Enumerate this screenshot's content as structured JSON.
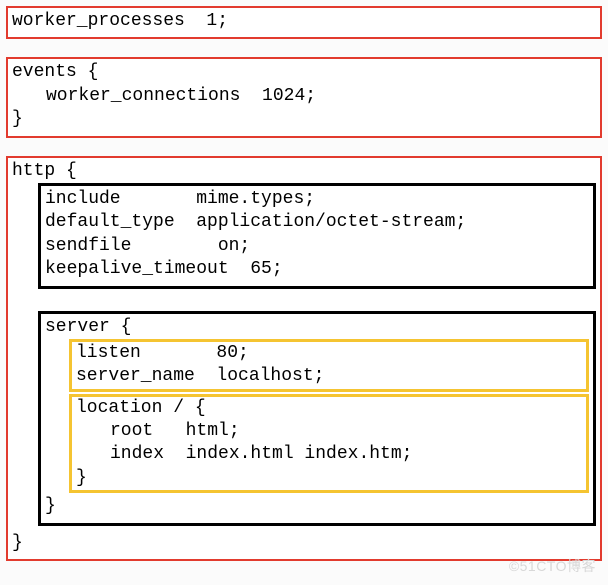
{
  "block1": {
    "line1": "worker_processes  1;"
  },
  "block2": {
    "line1": "events {",
    "line2": "worker_connections  1024;",
    "line3": "}"
  },
  "http": {
    "open": "http {",
    "close": "}",
    "globals": {
      "line1": "include       mime.types;",
      "line2": "default_type  application/octet-stream;",
      "line3": "sendfile        on;",
      "line4": "keepalive_timeout  65;"
    },
    "server": {
      "open": "server {",
      "close": "}",
      "listen_block": {
        "line1": "listen       80;",
        "line2": "server_name  localhost;"
      },
      "location_block": {
        "line1": "location / {",
        "line2": "root   html;",
        "line3": "index  index.html index.htm;",
        "line4": "}"
      }
    }
  },
  "watermark": "©51CTO博客"
}
